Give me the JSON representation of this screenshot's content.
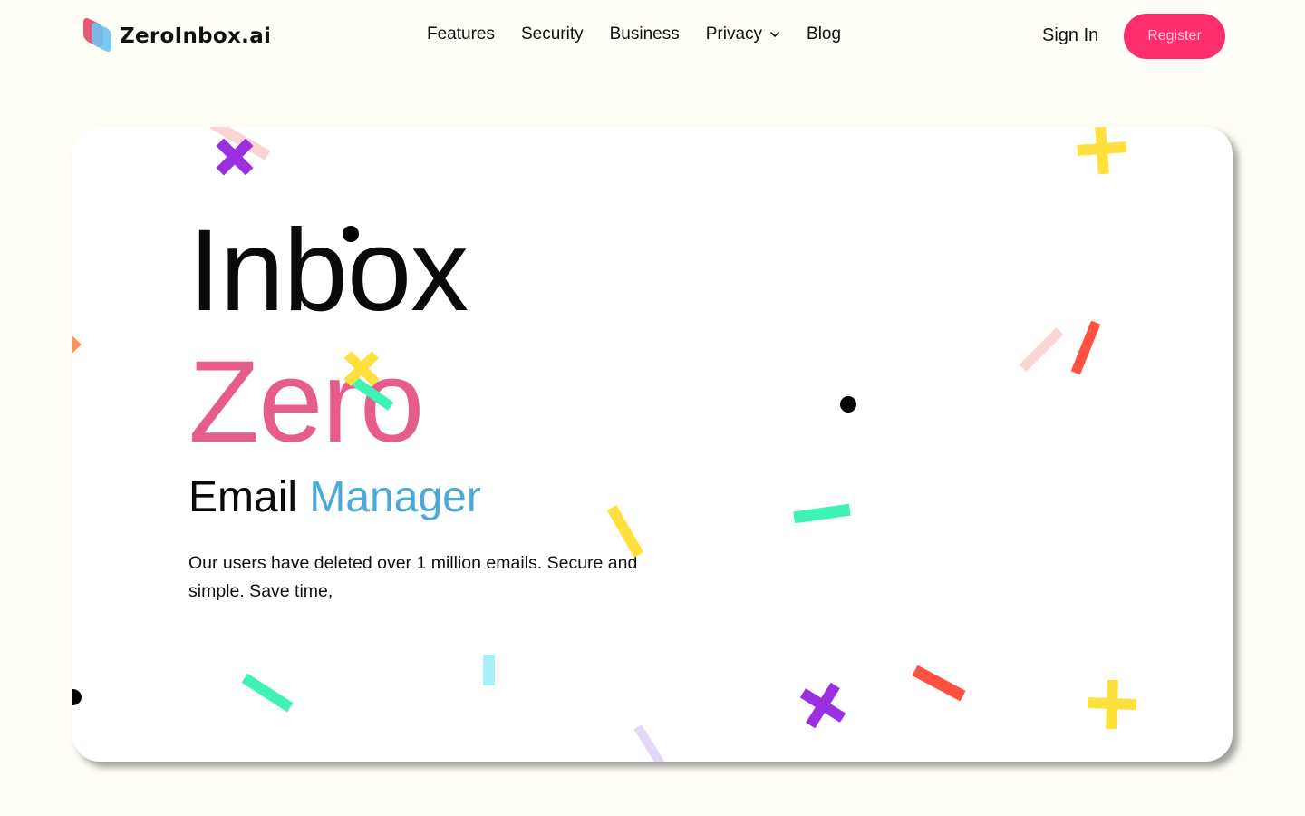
{
  "brand": {
    "name": "ZeroInbox.ai",
    "logo_icon": "layered-envelope-logo-icon"
  },
  "nav": {
    "items": [
      {
        "label": "Features"
      },
      {
        "label": "Security"
      },
      {
        "label": "Business"
      },
      {
        "label": "Privacy",
        "has_dropdown": true,
        "icon": "chevron-down-icon"
      },
      {
        "label": "Blog"
      }
    ],
    "sign_in": "Sign In",
    "register": "Register"
  },
  "hero": {
    "title_line1": "Inbox",
    "title_line2": "Zero",
    "subtitle_part1": "Email",
    "subtitle_part2": "Manager",
    "description": "Our users have deleted over 1 million emails. Secure and simple. Save time,"
  },
  "colors": {
    "page_background": "#fefef6",
    "register_button": "#ff2e6d",
    "title_zero": "#e65c8c",
    "subtitle_accent": "#4aa9d8",
    "confetti": [
      "#9b30e0",
      "#ffe03d",
      "#3ff2b5",
      "#ff5040",
      "#fcd4d4",
      "#a8f0f8",
      "#e4d8f8",
      "#ff9060",
      "#000000"
    ]
  }
}
